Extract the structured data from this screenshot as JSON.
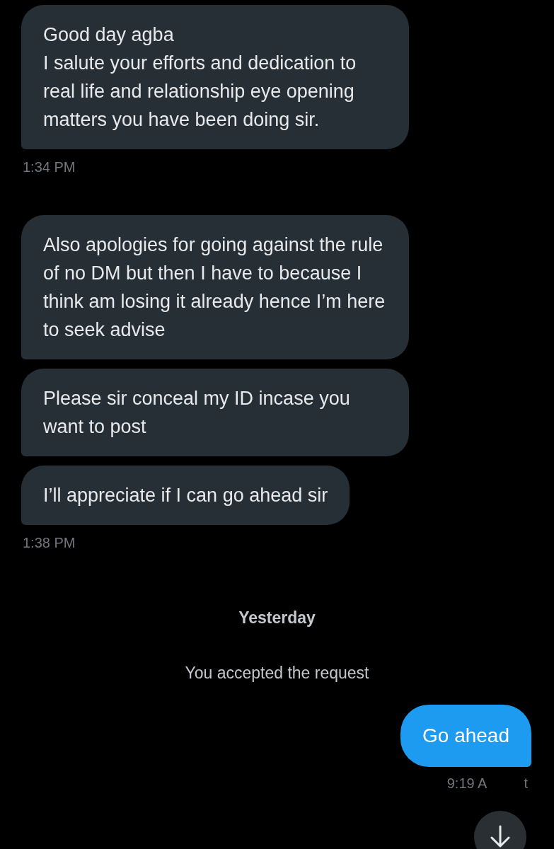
{
  "messages": [
    {
      "kind": "incoming",
      "text": "Good day agba\nI salute your efforts and dedication to real life and relationship eye opening matters you have been doing sir."
    },
    {
      "kind": "time",
      "text": "1:34 PM"
    },
    {
      "kind": "incoming",
      "text": "Also apologies for going against the rule of no DM but then I have to because I think am losing it already hence I’m here to seek advise"
    },
    {
      "kind": "incoming",
      "text": "Please sir conceal my ID incase you want to post"
    },
    {
      "kind": "incoming",
      "text": "I’ll appreciate if I can go ahead sir"
    },
    {
      "kind": "time",
      "text": "1:38 PM"
    },
    {
      "kind": "separator",
      "text": "Yesterday"
    },
    {
      "kind": "system",
      "text": "You accepted the request"
    },
    {
      "kind": "outgoing",
      "text": "Go ahead"
    },
    {
      "kind": "outgoing_time",
      "text": "9:19 A",
      "text_end": "t"
    }
  ]
}
